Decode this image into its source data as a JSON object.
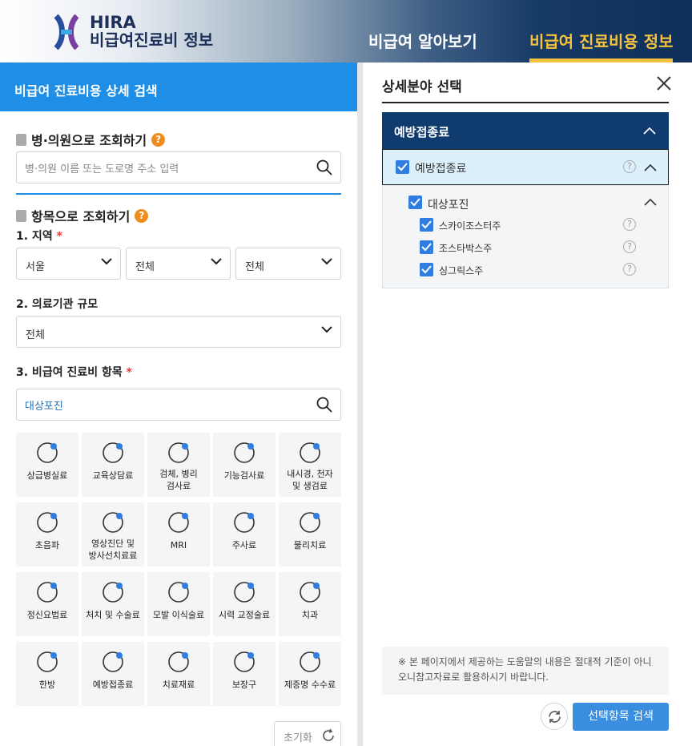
{
  "header": {
    "brand_top": "HIRA",
    "brand_bottom": "비급여진료비 정보",
    "nav": [
      "비급여 알아보기",
      "비급여 진료비용 정보"
    ]
  },
  "left": {
    "title": "비급여 진료비용 상세 검색",
    "hospital_section": "병·의원으로 조회하기",
    "hospital_placeholder": "병·의원 이름 또는 도로명 주소 입력",
    "item_section": "항목으로 조회하기",
    "q1": "1. 지역",
    "regions": [
      "서울",
      "전체",
      "전체"
    ],
    "q2": "2. 의료기관 규모",
    "scale": "전체",
    "q3": "3. 비급여 진료비 항목",
    "item_value": "대상포진",
    "tiles": [
      [
        "상급병실료"
      ],
      [
        "교육상담료"
      ],
      [
        "검체, 병리",
        "검사료"
      ],
      [
        "기능검사료"
      ],
      [
        "내시경, 천자",
        "및 생검료"
      ],
      [
        "초음파"
      ],
      [
        "영상진단 및",
        "방사선치료료"
      ],
      [
        "MRI"
      ],
      [
        "주사료"
      ],
      [
        "물리치료"
      ],
      [
        "정신요법료"
      ],
      [
        "처치 및 수술료"
      ],
      [
        "모발 이식술료"
      ],
      [
        "시력 교정술료"
      ],
      [
        "치과"
      ],
      [
        "한방"
      ],
      [
        "예방접종료"
      ],
      [
        "치료재료"
      ],
      [
        "보장구"
      ],
      [
        "제증명 수수료"
      ]
    ],
    "reset": "초기화"
  },
  "right": {
    "title": "상세분야 선택",
    "category": "예방접종료",
    "item": "예방접종료",
    "subgroup": "대상포진",
    "vaccines": [
      "스카이조스터주",
      "조스타박스주",
      "싱그릭스주"
    ],
    "notice_line1": "※ 본 페이지에서 제공하는 도움말의 내용은 절대적 기준이 아니",
    "notice_line2": "오니참고자료로 활용하시기 바랍니다.",
    "search_button": "선택항목 검색"
  },
  "colors": {
    "accent_blue": "#1e8ee6",
    "navy": "#0f3b6e",
    "gold": "#f5c23d",
    "orange": "#f08c1e"
  }
}
